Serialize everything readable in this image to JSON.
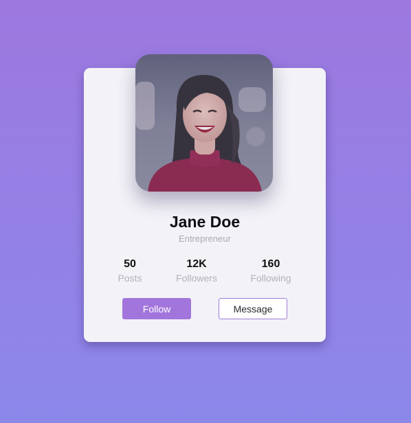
{
  "profile": {
    "name": "Jane Doe",
    "role": "Entrepreneur"
  },
  "stats": [
    {
      "value": "50",
      "label": "Posts"
    },
    {
      "value": "12K",
      "label": "Followers"
    },
    {
      "value": "160",
      "label": "Following"
    }
  ],
  "actions": {
    "follow_label": "Follow",
    "message_label": "Message"
  },
  "colors": {
    "accent": "#a275dc",
    "background_top": "#9d78df",
    "background_bottom": "#8c88ea",
    "card": "#f2f2f7"
  }
}
